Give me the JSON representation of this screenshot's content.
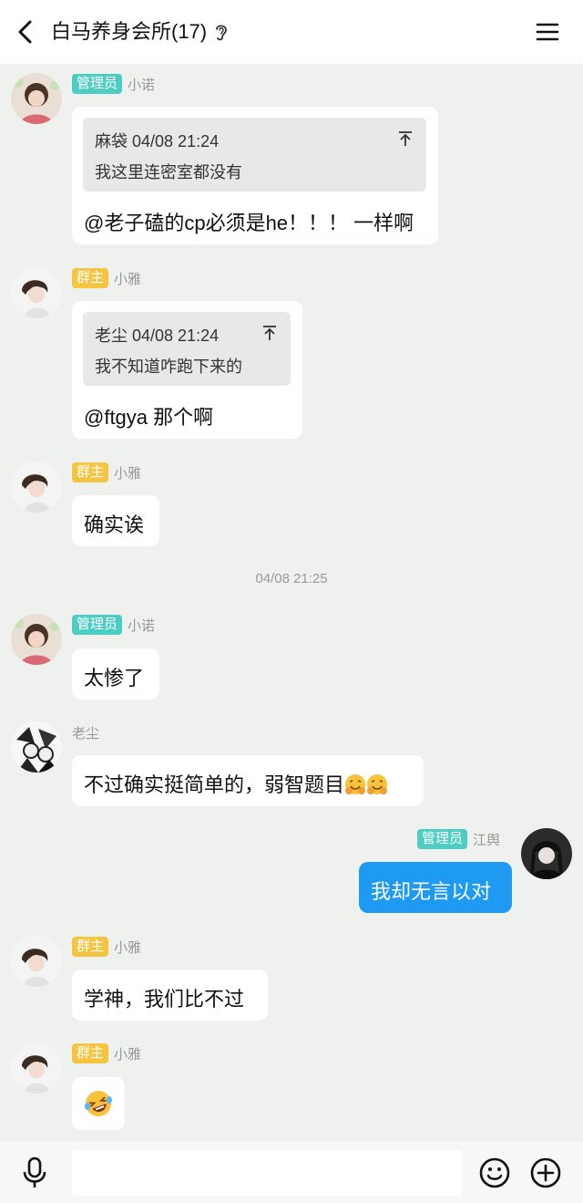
{
  "header": {
    "title": "白马养身会所(17)",
    "back_icon": "back-arrow-icon",
    "ear_icon": "ear-icon",
    "menu_icon": "menu-icon"
  },
  "colors": {
    "admin_badge": "#4ecdc4",
    "owner_badge": "#f5c542",
    "my_bubble": "#1e9af3",
    "background": "#eef1ee"
  },
  "messages": [
    {
      "role_badge": "管理员",
      "sender": "小诺",
      "quote_author_time": "麻袋 04/08 21:24",
      "quote_text": "我这里连密室都没有",
      "text": "@老子磕的cp必须是he！！！  一样啊"
    },
    {
      "role_badge": "群主",
      "sender": "小雅",
      "quote_author_time": "老尘 04/08 21:24",
      "quote_text": "我不知道咋跑下来的",
      "text": "@ftgya 那个啊"
    },
    {
      "role_badge": "群主",
      "sender": "小雅",
      "text": "确实诶"
    },
    {
      "role_badge": "管理员",
      "sender": "小诺",
      "text": "太惨了"
    },
    {
      "sender": "老尘",
      "text": "不过确实挺简单的，弱智题目"
    },
    {
      "role_badge": "管理员",
      "sender": "江舆",
      "text": "我却无言以对"
    },
    {
      "role_badge": "群主",
      "sender": "小雅",
      "text": "学神，我们比不过"
    },
    {
      "role_badge": "群主",
      "sender": "小雅",
      "emoji": "laughing-tears-emoji"
    }
  ],
  "timestamp": "04/08 21:25",
  "input": {
    "value": "",
    "placeholder": ""
  },
  "toolbar": {
    "mic_icon": "microphone-icon",
    "emoji_icon": "smiley-icon",
    "plus_icon": "plus-circle-icon"
  }
}
